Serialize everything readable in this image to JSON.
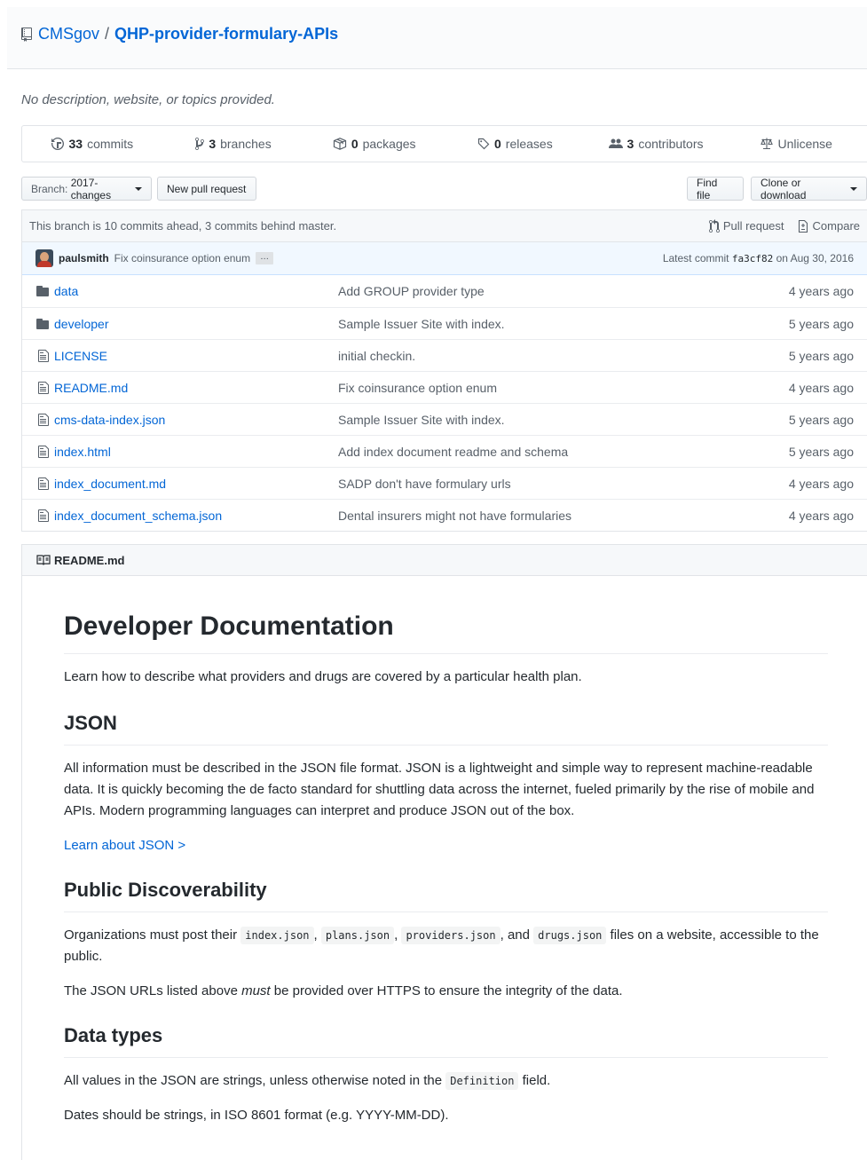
{
  "repo": {
    "owner": "CMSgov",
    "separator": "/",
    "name": "QHP-provider-formulary-APIs"
  },
  "description": "No description, website, or topics provided.",
  "summary": [
    {
      "count": "33",
      "label": "commits",
      "icon": "history-icon"
    },
    {
      "count": "3",
      "label": "branches",
      "icon": "branch-icon"
    },
    {
      "count": "0",
      "label": "packages",
      "icon": "package-icon"
    },
    {
      "count": "0",
      "label": "releases",
      "icon": "tag-icon"
    },
    {
      "count": "3",
      "label": "contributors",
      "icon": "people-icon"
    },
    {
      "count": "",
      "label": "Unlicense",
      "icon": "law-icon"
    }
  ],
  "toolbar": {
    "branch_prefix": "Branch:",
    "branch_name": "2017-changes",
    "new_pr": "New pull request",
    "find_file": "Find file",
    "clone": "Clone or download"
  },
  "branch_info": {
    "text": "This branch is 10 commits ahead, 3 commits behind master.",
    "pull_request": "Pull request",
    "compare": "Compare"
  },
  "latest_commit": {
    "author": "paulsmith",
    "message": "Fix coinsurance option enum",
    "ellipsis": "…",
    "prefix": "Latest commit",
    "sha": "fa3cf82",
    "date": "on Aug 30, 2016"
  },
  "files": [
    {
      "type": "dir",
      "name": "data",
      "message": "Add GROUP provider type",
      "age": "4 years ago"
    },
    {
      "type": "dir",
      "name": "developer",
      "message": "Sample Issuer Site with index.",
      "age": "5 years ago"
    },
    {
      "type": "file",
      "name": "LICENSE",
      "message": "initial checkin.",
      "age": "5 years ago"
    },
    {
      "type": "file",
      "name": "README.md",
      "message": "Fix coinsurance option enum",
      "age": "4 years ago"
    },
    {
      "type": "file",
      "name": "cms-data-index.json",
      "message": "Sample Issuer Site with index.",
      "age": "5 years ago"
    },
    {
      "type": "file",
      "name": "index.html",
      "message": "Add index document readme and schema",
      "age": "5 years ago"
    },
    {
      "type": "file",
      "name": "index_document.md",
      "message": "SADP don't have formulary urls",
      "age": "4 years ago"
    },
    {
      "type": "file",
      "name": "index_document_schema.json",
      "message": "Dental insurers might not have formularies",
      "age": "4 years ago"
    }
  ],
  "readme": {
    "filename": "README.md",
    "h1": "Developer Documentation",
    "intro": "Learn how to describe what providers and drugs are covered by a particular health plan.",
    "json_h2": "JSON",
    "json_p": "All information must be described in the JSON file format. JSON is a lightweight and simple way to represent machine-readable data. It is quickly becoming the de facto standard for shuttling data across the internet, fueled primarily by the rise of mobile and APIs. Modern programming languages can interpret and produce JSON out of the box.",
    "json_link": "Learn about JSON >",
    "disc_h2": "Public Discoverability",
    "disc_p1_a": "Organizations must post their ",
    "disc_code1": "index.json",
    "disc_comma1": ", ",
    "disc_code2": "plans.json",
    "disc_comma2": ", ",
    "disc_code3": "providers.json",
    "disc_and": ", and ",
    "disc_code4": "drugs.json",
    "disc_p1_b": " files on a website, accessible to the public.",
    "disc_p2_a": "The JSON URLs listed above ",
    "disc_p2_em": "must",
    "disc_p2_b": " be provided over HTTPS to ensure the integrity of the data.",
    "types_h2": "Data types",
    "types_p1_a": "All values in the JSON are strings, unless otherwise noted in the ",
    "types_code": "Definition",
    "types_p1_b": " field.",
    "types_p2": "Dates should be strings, in ISO 8601 format (e.g. YYYY-MM-DD)."
  },
  "colors": {
    "link": "#0366d6",
    "muted": "#586069",
    "text": "#24292e"
  }
}
